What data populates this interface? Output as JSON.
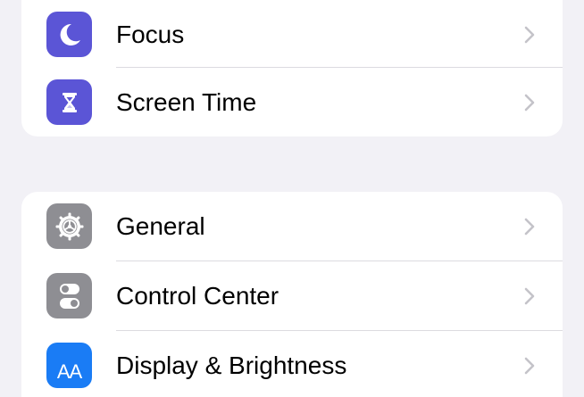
{
  "groups": [
    {
      "items": [
        {
          "label": "Focus",
          "icon": "moon-icon",
          "icon_color": "#5b55d6"
        },
        {
          "label": "Screen Time",
          "icon": "hourglass-icon",
          "icon_color": "#5b55d6"
        }
      ]
    },
    {
      "items": [
        {
          "label": "General",
          "icon": "gear-icon",
          "icon_color": "#8e8e93"
        },
        {
          "label": "Control Center",
          "icon": "toggles-icon",
          "icon_color": "#8e8e93"
        },
        {
          "label": "Display & Brightness",
          "icon": "text-size-icon",
          "icon_color": "#1a7cf5",
          "icon_text": "AA"
        }
      ]
    }
  ],
  "colors": {
    "background": "#f2f1f6",
    "card": "#ffffff",
    "separator": "#dcdbe0",
    "chevron": "#c4c3c9"
  }
}
